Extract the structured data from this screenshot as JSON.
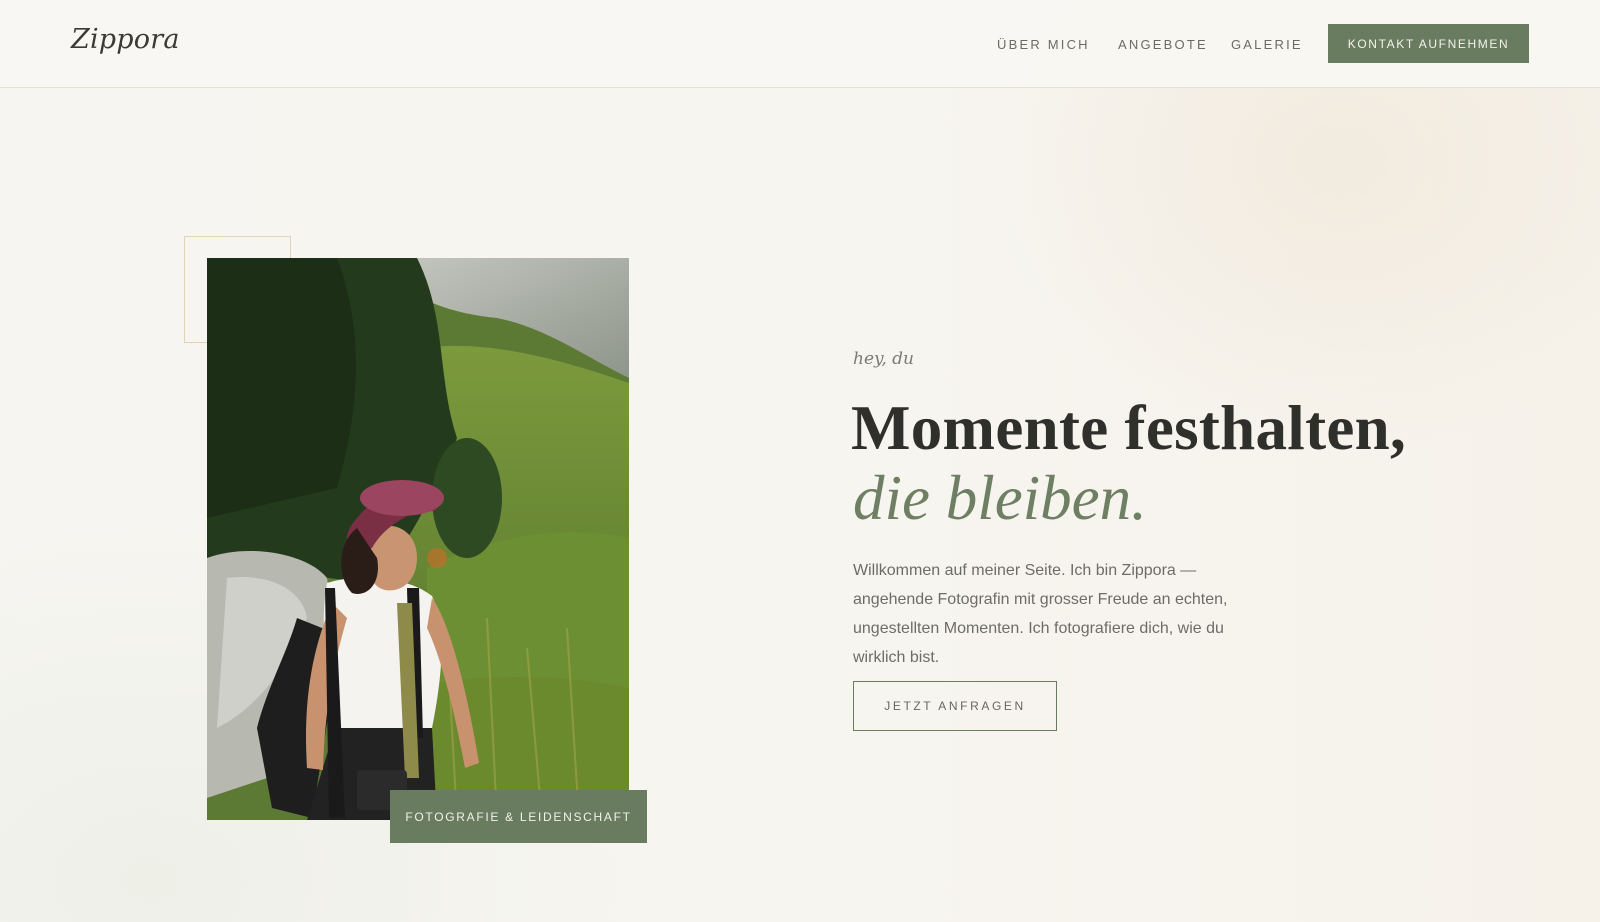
{
  "header": {
    "logo": "Zippora",
    "nav": [
      {
        "label": "ÜBER MICH"
      },
      {
        "label": "ANGEBOTE"
      },
      {
        "label": "GALERIE"
      }
    ],
    "cta_label": "KONTAKT AUFNEHMEN"
  },
  "hero": {
    "eyebrow": "hey, du",
    "headline_line1": "Momente festhalten,",
    "headline_line2": "die bleiben.",
    "intro": "Willkommen auf meiner Seite. Ich bin Zippora — angehende Fotografin mit grosser Freude an echten, ungestellten Momenten. Ich fotografiere dich, wie du wirklich bist.",
    "cta_label": "JETZT ANFRAGEN",
    "photo_badge": "FOTOGRAFIE & LEIDENSCHAFT"
  },
  "colors": {
    "accent": "#6a7c5f",
    "background": "#f7f5f0",
    "deco_frame": "#e3d3b4",
    "text_dark": "#2f2f2b"
  }
}
